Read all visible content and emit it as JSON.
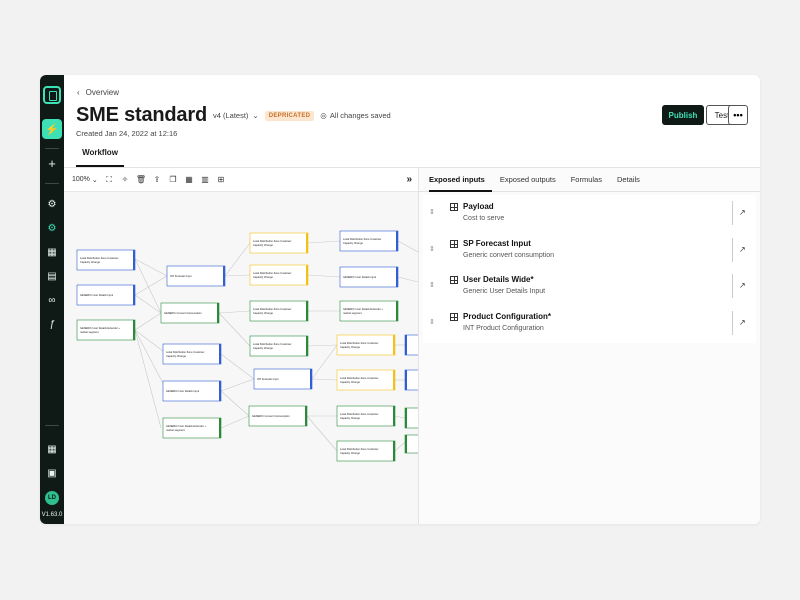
{
  "breadcrumb": {
    "label": "Overview"
  },
  "header": {
    "title": "SME standard",
    "version": "v4 (Latest)",
    "badge": "DEPRICATED",
    "saved": "All changes saved",
    "created": "Created Jan 24, 2022 at 12:16",
    "publish_label": "Publish",
    "test_label": "Test",
    "more_label": "•••"
  },
  "tabs": {
    "workflow": "Workflow"
  },
  "toolbar": {
    "zoom": "100%"
  },
  "sidebar": {
    "version": "V1.63.0",
    "avatar": "LD"
  },
  "panel": {
    "tabs": [
      "Exposed inputs",
      "Exposed outputs",
      "Formulas",
      "Details"
    ],
    "items": [
      {
        "name": "Payload",
        "desc": "Cost to serve"
      },
      {
        "name": "SP Forecast Input",
        "desc": "Generic convert consumption"
      },
      {
        "name": "User Details Wide*",
        "desc": "Generic User Details Input"
      },
      {
        "name": "Product Configuration*",
        "desc": "INT Product Configuration"
      }
    ]
  },
  "colors": {
    "accent": "#3ee0b5",
    "dark": "#0f1a17",
    "blue": "#2f5fd0",
    "yellow": "#f2c21b",
    "green": "#2a8a3a"
  }
}
